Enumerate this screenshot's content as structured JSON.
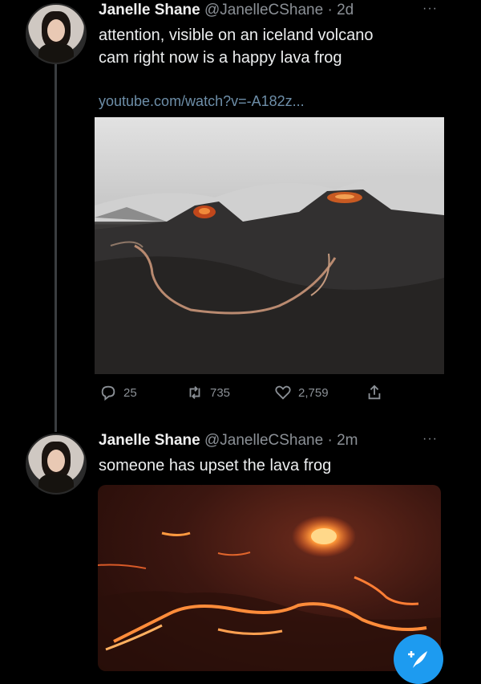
{
  "tweets": [
    {
      "name": "Janelle Shane",
      "handle": "@JanelleCShane",
      "time": "· 2d",
      "text_line1": "attention, visible on an iceland volcano",
      "text_line2": "cam right now is a happy lava frog",
      "link": "youtube.com/watch?v=-A182z...",
      "replies": "25",
      "retweets": "735",
      "likes": "2,759"
    },
    {
      "name": "Janelle Shane",
      "handle": "@JanelleCShane",
      "time": "· 2m",
      "text": "someone has upset the lava frog"
    }
  ],
  "more_glyph": "···",
  "icons": {
    "reply": "reply-icon",
    "retweet": "retweet-icon",
    "like": "heart-icon",
    "share": "share-icon",
    "compose": "compose-tweet-icon"
  },
  "colors": {
    "accent": "#1d9bf0",
    "background": "#000000",
    "muted": "#8b9096",
    "link": "#6d8ea8"
  }
}
